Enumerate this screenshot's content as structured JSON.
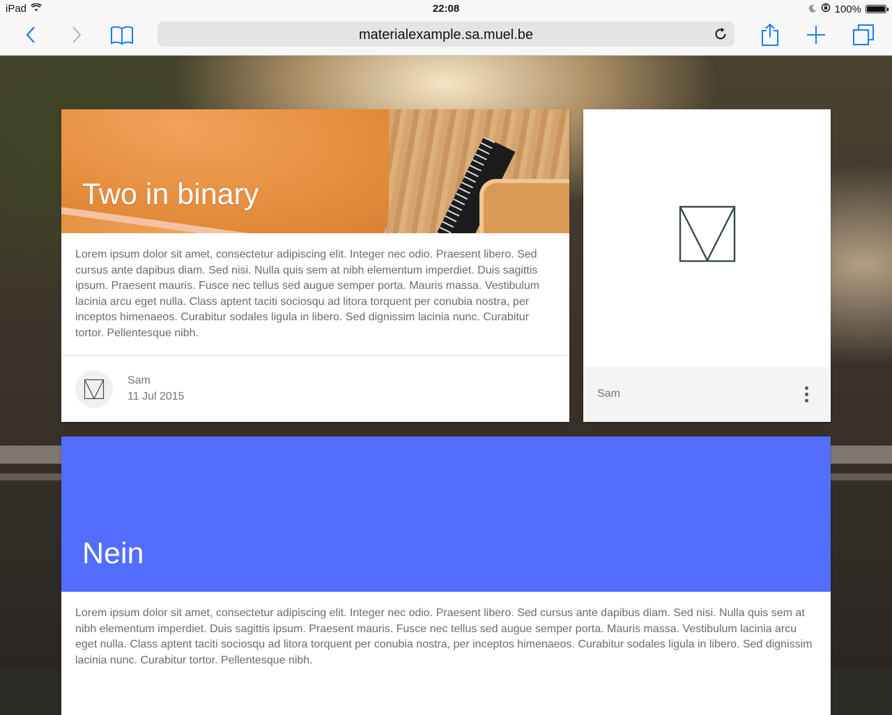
{
  "status_bar": {
    "device": "iPad",
    "time": "22:08",
    "battery": "100%",
    "wifi_icon": "wifi-icon",
    "moon_icon": "moon-icon",
    "orientation_lock_icon": "orientation-lock-icon",
    "battery_level": 1.0
  },
  "browser": {
    "url": "materialexample.sa.muel.be",
    "accent_color": "#1a7cf4"
  },
  "cards": {
    "binary": {
      "title": "Two in binary",
      "body": "Lorem ipsum dolor sit amet, consectetur adipiscing elit. Integer nec odio. Praesent libero. Sed cursus ante dapibus diam. Sed nisi. Nulla quis sem at nibh elementum imperdiet. Duis sagittis ipsum. Praesent mauris. Fusce nec tellus sed augue semper porta. Mauris massa. Vestibulum lacinia arcu eget nulla. Class aptent taciti sociosqu ad litora torquent per conubia nostra, per inceptos himenaeos. Curabitur sodales ligula in libero. Sed dignissim lacinia nunc. Curabitur tortor. Pellentesque nibh.",
      "author": "Sam",
      "date": "11 Jul 2015"
    },
    "logo_card": {
      "author": "Sam"
    },
    "nein": {
      "title": "Nein",
      "color": "#536dfe",
      "body": "Lorem ipsum dolor sit amet, consectetur adipiscing elit. Integer nec odio. Praesent libero. Sed cursus ante dapibus diam. Sed nisi. Nulla quis sem at nibh elementum imperdiet. Duis sagittis ipsum. Praesent mauris. Fusce nec tellus sed augue semper porta. Mauris massa. Vestibulum lacinia arcu eget nulla. Class aptent taciti sociosqu ad litora torquent per conubia nostra, per inceptos himenaeos. Curabitur sodales ligula in libero. Sed dignissim lacinia nunc. Curabitur tortor. Pellentesque nibh."
    }
  }
}
